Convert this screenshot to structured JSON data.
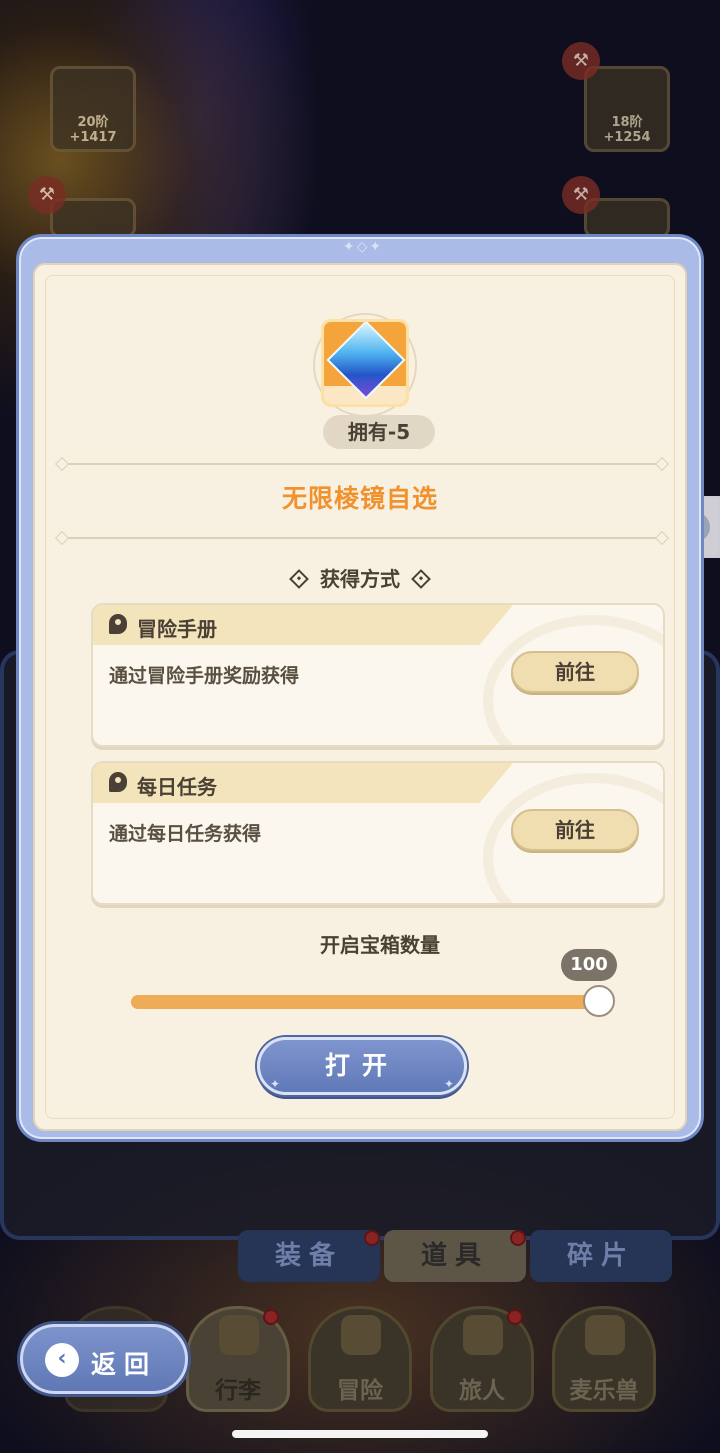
{
  "background": {
    "equip_slots": [
      {
        "level": "20阶",
        "bonus": "+1417"
      },
      {
        "level": "18阶",
        "bonus": "+1254"
      }
    ],
    "tabs": [
      {
        "label": "装备",
        "active": false
      },
      {
        "label": "道具",
        "active": true
      },
      {
        "label": "碎片",
        "active": false
      }
    ],
    "nav": [
      {
        "label": "行李",
        "active": true
      },
      {
        "label": "冒险",
        "active": false
      },
      {
        "label": "旅人",
        "active": false
      },
      {
        "label": "麦乐兽",
        "active": false
      }
    ],
    "back_label": "返回"
  },
  "modal": {
    "owned_text": "拥有-5",
    "item_title": "无限棱镜自选",
    "section_title": "获得方式",
    "sources": [
      {
        "title": "冒险手册",
        "desc": "通过冒险手册奖励获得",
        "button": "前往"
      },
      {
        "title": "每日任务",
        "desc": "通过每日任务获得",
        "button": "前往"
      }
    ],
    "quantity_label": "开启宝箱数量",
    "quantity_value": "100",
    "slider_fraction": 1.0,
    "open_button": "打开"
  },
  "colors": {
    "accent_orange": "#f0922e",
    "primary_blue": "#6079b7",
    "panel_cream": "#f8f1e2"
  },
  "icons": [
    "hammer-icon",
    "chat-icon",
    "back-arrow-icon",
    "bookmark-icon",
    "diamond-icon"
  ]
}
